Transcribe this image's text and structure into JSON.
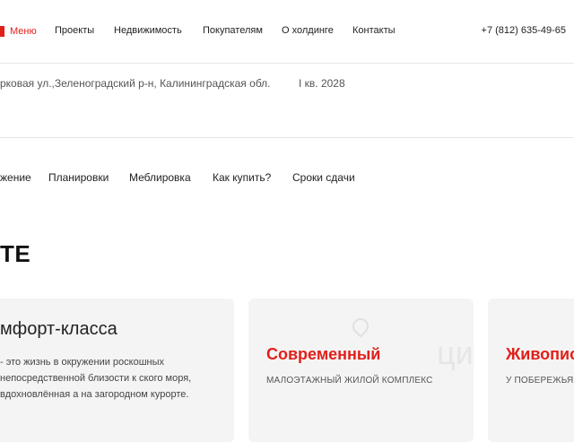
{
  "nav": {
    "menu_label": "Меню",
    "links": [
      "Проекты",
      "Недвижимость",
      "Покупателям",
      "О холдинге",
      "Контакты"
    ],
    "phone": "+7 (812) 635-49-65"
  },
  "info": {
    "address": "рковая ул.,Зеленоградский р-н, Калининградская обл.",
    "completion": "I кв. 2028"
  },
  "tabs": [
    "жение",
    "Планировки",
    "Меблировка",
    "Как купить?",
    "Сроки сдачи"
  ],
  "section": {
    "heading": "ТЕ"
  },
  "cards": [
    {
      "title": "мфорт-класса",
      "body": "- это жизнь в окружении роскошных непосредственной близости к ского моря, вдохновлённая а на загородном курорте."
    },
    {
      "title": "Современный",
      "subtitle": "МАЛОЭТАЖНЫЙ ЖИЛОЙ КОМПЛЕКС",
      "watermark": "циан"
    },
    {
      "title": "Живопис",
      "subtitle": "У ПОБЕРЕЖЬЯ"
    }
  ],
  "colors": {
    "accent": "#e1201a",
    "card_bg": "#f4f4f4"
  }
}
